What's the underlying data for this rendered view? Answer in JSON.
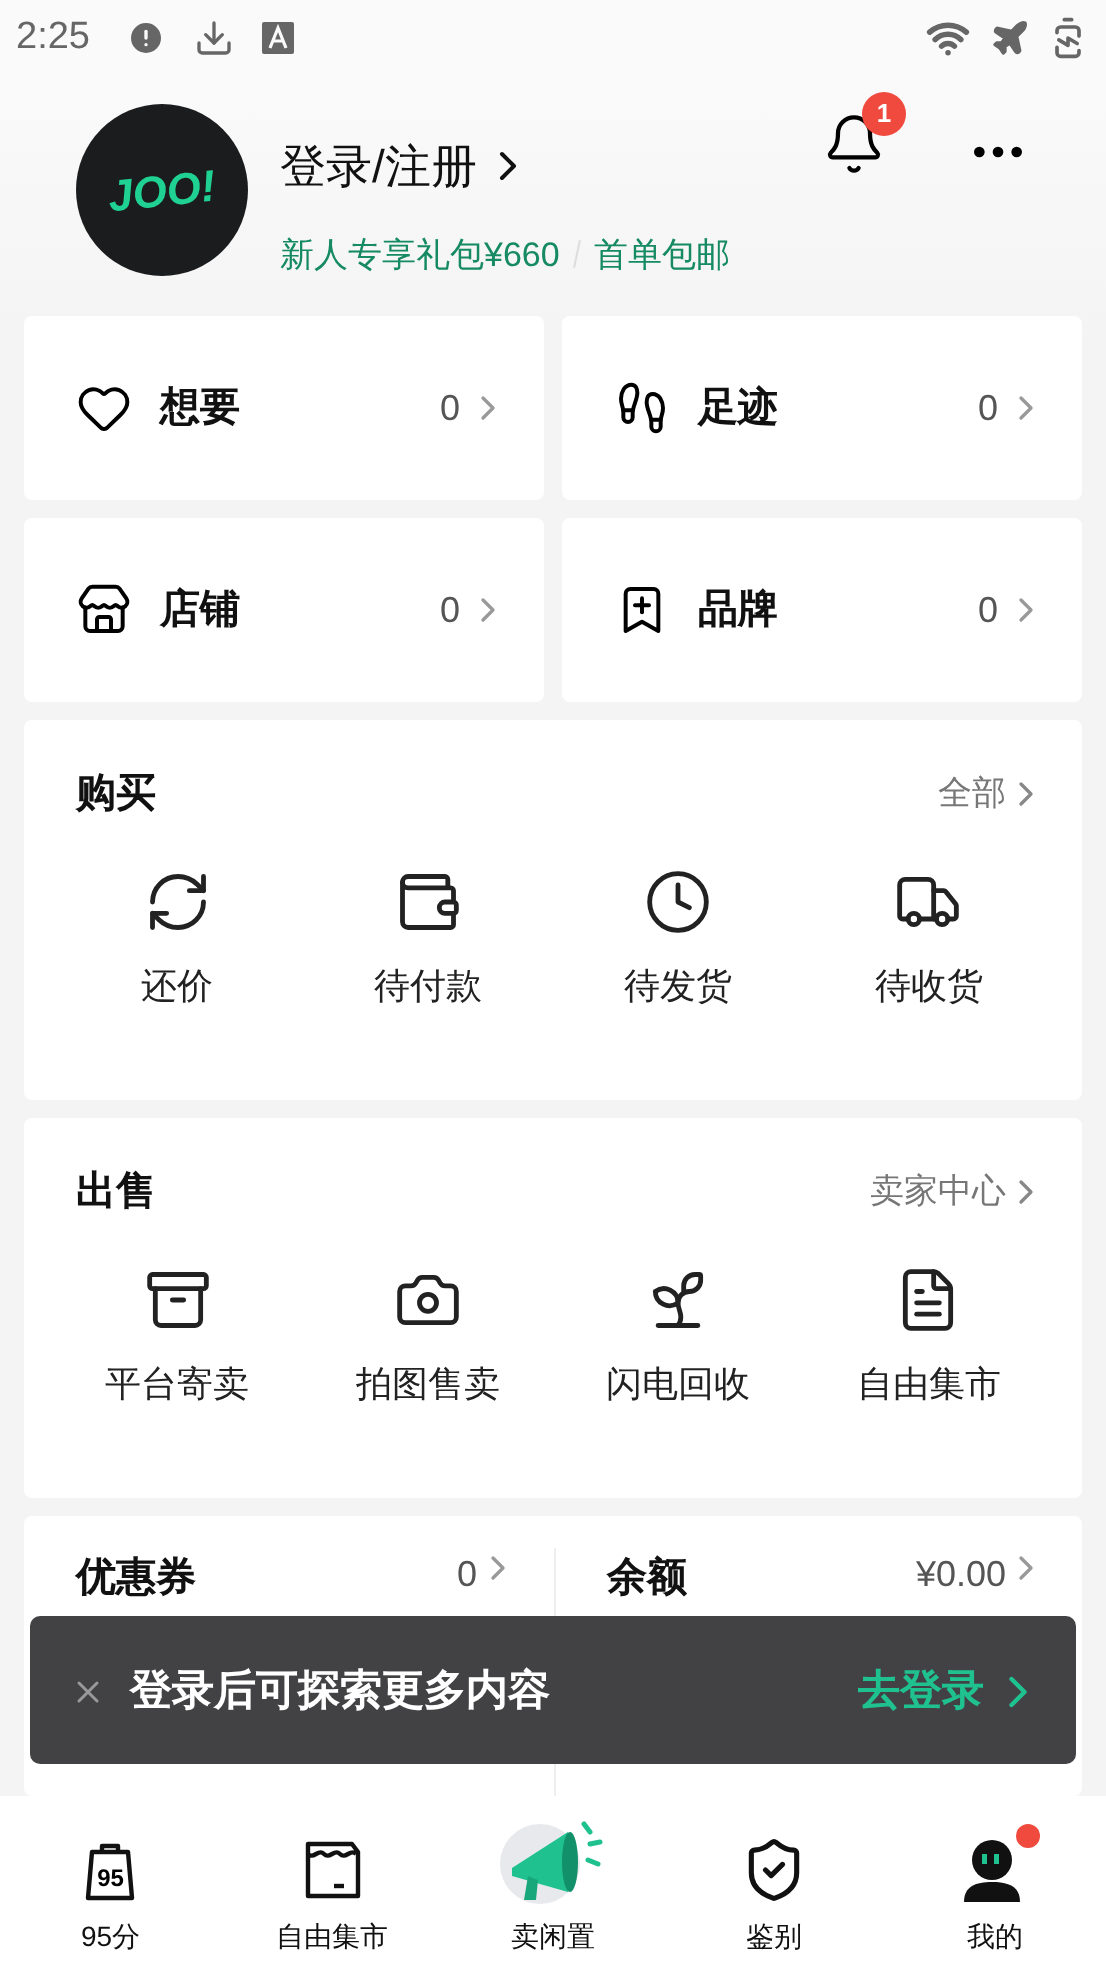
{
  "status_bar": {
    "time": "2:25"
  },
  "profile": {
    "logo": "JOO!",
    "login": "登录/注册",
    "perks": [
      "新人专享礼包¥660",
      "首单包邮"
    ],
    "notification_count": "1"
  },
  "quick_tiles": [
    {
      "kind": "heart",
      "label": "想要",
      "count": "0"
    },
    {
      "kind": "foot",
      "label": "足迹",
      "count": "0"
    },
    {
      "kind": "store",
      "label": "店铺",
      "count": "0"
    },
    {
      "kind": "brand",
      "label": "品牌",
      "count": "0"
    }
  ],
  "sections": [
    {
      "title": "购买",
      "link": "全部",
      "items": [
        {
          "kind": "bargain",
          "label": "还价"
        },
        {
          "kind": "wallet",
          "label": "待付款"
        },
        {
          "kind": "clock",
          "label": "待发货"
        },
        {
          "kind": "truck",
          "label": "待收货"
        }
      ]
    },
    {
      "title": "出售",
      "link": "卖家中心",
      "items": [
        {
          "kind": "archive",
          "label": "平台寄卖"
        },
        {
          "kind": "camera",
          "label": "拍图售卖"
        },
        {
          "kind": "recycle",
          "label": "闪电回收"
        },
        {
          "kind": "note",
          "label": "自由集市"
        }
      ]
    }
  ],
  "wallet": [
    {
      "label": "优惠券",
      "value": "0"
    },
    {
      "label": "余额",
      "value": "¥0.00"
    }
  ],
  "toast": {
    "message": "登录后可探索更多内容",
    "action": "去登录"
  },
  "tab_bar": [
    {
      "kind": "bag",
      "icon_text": "95",
      "label": "95分",
      "dot": false
    },
    {
      "kind": "market",
      "label": "自由集市",
      "dot": false
    },
    {
      "kind": "megaphone",
      "label": "卖闲置",
      "dot": false
    },
    {
      "kind": "shield",
      "label": "鉴别",
      "dot": false
    },
    {
      "kind": "avatar",
      "label": "我的",
      "dot": true
    }
  ]
}
